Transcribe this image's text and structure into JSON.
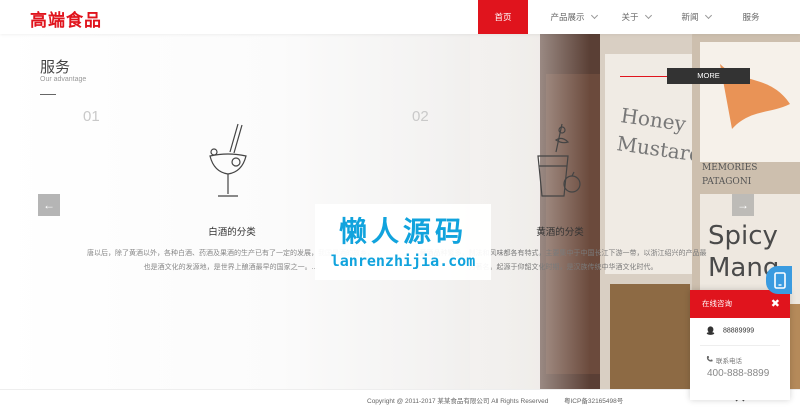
{
  "header": {
    "logo": "高端食品",
    "nav": [
      {
        "label": "首页",
        "active": true,
        "dropdown": false
      },
      {
        "label": "产品展示",
        "active": false,
        "dropdown": true
      },
      {
        "label": "关于",
        "active": false,
        "dropdown": true
      },
      {
        "label": "新闻",
        "active": false,
        "dropdown": true
      },
      {
        "label": "服务",
        "active": false,
        "dropdown": false
      }
    ]
  },
  "section": {
    "title": "服务",
    "subtitle": "Our advantage",
    "more_label": "MORE"
  },
  "cards": [
    {
      "number": "01",
      "title": "白酒的分类",
      "text_line1": "唐以后，除了黄酒以外，各种白酒、药酒及果酒的生产已有了一定的发展，我国是酒的故乡，",
      "text_line2": "也是酒文化的发源地，是世界上酿酒最早的国家之一。...",
      "icon": "cocktail-glass-icon"
    },
    {
      "number": "02",
      "title": "黄酒的分类",
      "text_line1": "黄酒品种繁多，制法和风味都各有特式，主要集中于中国长江下游一带，以浙江绍兴的产品最",
      "text_line2": "为著名。起源于仰韶文化时期，是汉族传统中华酒文化时代。",
      "icon": "cocktail-with-fruit-icon"
    }
  ],
  "carousel": {
    "prev_icon": "arrow-left-icon",
    "next_icon": "arrow-right-icon"
  },
  "watermark": {
    "cn": "懒人源码",
    "en": "lanrenzhijia.com"
  },
  "photo_labels": {
    "honey": "Honey",
    "mustard": "Mustard",
    "memories": "MEMORIES",
    "patagonia": "PATAGONI",
    "spicy": "Spicy",
    "mango": "Mang"
  },
  "footer": {
    "copyright": "Copyright @ 2011-2017 某某食品有限公司 All Rights Reserved",
    "icp": "粤ICP备32165498号"
  },
  "consult": {
    "title": "在线咨询",
    "qq": "88889999",
    "contact_label": "联系电话",
    "phone": "400-888-8899"
  },
  "colors": {
    "brand_red": "#e0141d",
    "watermark_blue": "#11a3dd",
    "phone_tab_blue": "#3a9be0"
  }
}
